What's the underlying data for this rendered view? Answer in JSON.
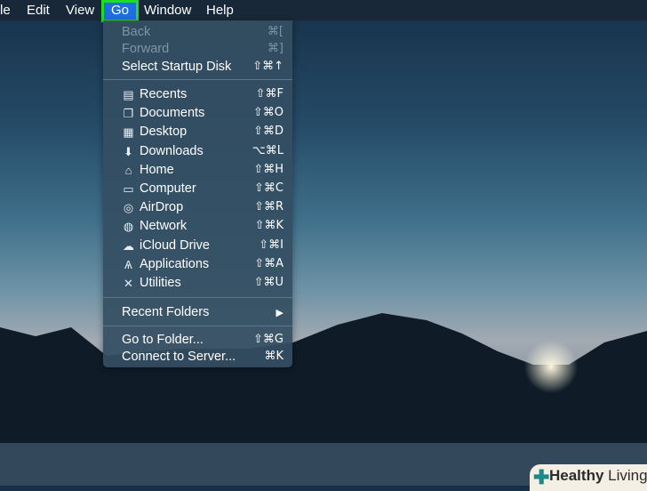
{
  "menubar": {
    "items": [
      "le",
      "Edit",
      "View",
      "Go",
      "Window",
      "Help"
    ]
  },
  "menu": {
    "nav": [
      {
        "label": "Back",
        "shortcut": "⌘[",
        "disabled": true
      },
      {
        "label": "Forward",
        "shortcut": "⌘]",
        "disabled": true
      },
      {
        "label": "Select Startup Disk",
        "shortcut": "⇧⌘↑"
      }
    ],
    "places": [
      {
        "label": "Recents",
        "shortcut": "⇧⌘F",
        "icon": "recents-icon",
        "glyph": "▤"
      },
      {
        "label": "Documents",
        "shortcut": "⇧⌘O",
        "icon": "documents-icon",
        "glyph": "❐"
      },
      {
        "label": "Desktop",
        "shortcut": "⇧⌘D",
        "icon": "desktop-icon",
        "glyph": "▦"
      },
      {
        "label": "Downloads",
        "shortcut": "⌥⌘L",
        "icon": "downloads-icon",
        "glyph": "⬇"
      },
      {
        "label": "Home",
        "shortcut": "⇧⌘H",
        "icon": "home-icon",
        "glyph": "⌂"
      },
      {
        "label": "Computer",
        "shortcut": "⇧⌘C",
        "icon": "computer-icon",
        "glyph": "▭"
      },
      {
        "label": "AirDrop",
        "shortcut": "⇧⌘R",
        "icon": "airdrop-icon",
        "glyph": "◎"
      },
      {
        "label": "Network",
        "shortcut": "⇧⌘K",
        "icon": "network-icon",
        "glyph": "◍"
      },
      {
        "label": "iCloud Drive",
        "shortcut": "⇧⌘I",
        "icon": "cloud-icon",
        "glyph": "☁"
      },
      {
        "label": "Applications",
        "shortcut": "⇧⌘A",
        "icon": "applications-icon",
        "glyph": "Ѧ"
      },
      {
        "label": "Utilities",
        "shortcut": "⇧⌘U",
        "icon": "utilities-icon",
        "glyph": "✕"
      }
    ],
    "recent_folders": {
      "label": "Recent Folders",
      "arrow": "▶"
    },
    "server": [
      {
        "label": "Go to Folder...",
        "shortcut": "⇧⌘G"
      },
      {
        "label": "Connect to Server...",
        "shortcut": "⌘K"
      }
    ]
  },
  "watermark": {
    "bold": "Healthy",
    "rest": " Living"
  }
}
